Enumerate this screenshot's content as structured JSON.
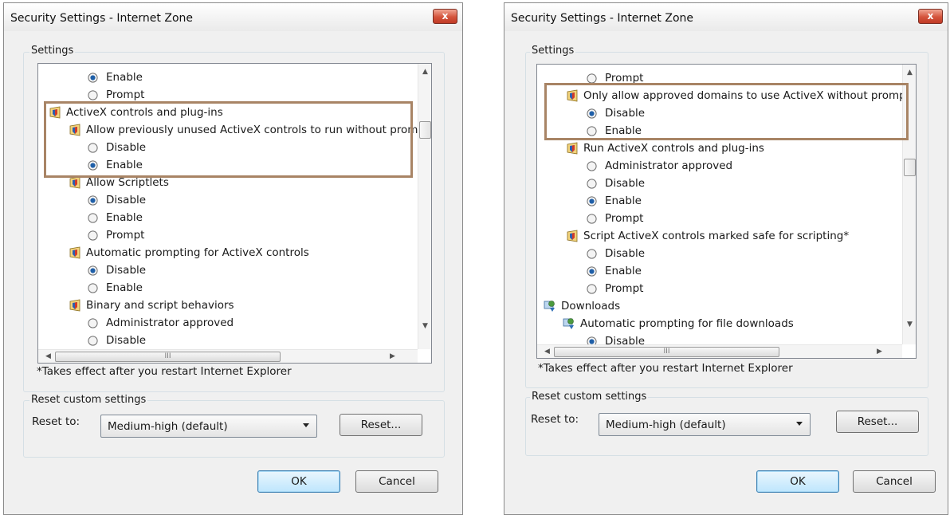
{
  "accent_colors": {
    "highlight": "#a88465",
    "close": "#c03a25",
    "default_button": "#bee6fd"
  },
  "dialogs": [
    {
      "title": "Security Settings - Internet Zone",
      "close_label": "x",
      "settings_legend": "Settings",
      "items": [
        {
          "type": "radio",
          "text": "Enable",
          "checked": true
        },
        {
          "type": "radio",
          "text": "Prompt",
          "checked": false
        },
        {
          "type": "header",
          "icon": "shield-icon",
          "text": "ActiveX controls and plug-ins"
        },
        {
          "type": "sub",
          "icon": "shield-icon",
          "text": "Allow previously unused ActiveX controls to run without prompt"
        },
        {
          "type": "radio",
          "text": "Disable",
          "checked": false
        },
        {
          "type": "radio",
          "text": "Enable",
          "checked": true
        },
        {
          "type": "sub",
          "icon": "shield-icon",
          "text": "Allow Scriptlets"
        },
        {
          "type": "radio",
          "text": "Disable",
          "checked": true
        },
        {
          "type": "radio",
          "text": "Enable",
          "checked": false
        },
        {
          "type": "radio",
          "text": "Prompt",
          "checked": false
        },
        {
          "type": "sub",
          "icon": "shield-icon",
          "text": "Automatic prompting for ActiveX controls"
        },
        {
          "type": "radio",
          "text": "Disable",
          "checked": true
        },
        {
          "type": "radio",
          "text": "Enable",
          "checked": false
        },
        {
          "type": "sub",
          "icon": "shield-icon",
          "text": "Binary and script behaviors"
        },
        {
          "type": "radio",
          "text": "Administrator approved",
          "checked": false
        },
        {
          "type": "radio",
          "text": "Disable",
          "checked": false
        }
      ],
      "scroll_grip": "III",
      "note": "*Takes effect after you restart Internet Explorer",
      "reset_legend": "Reset custom settings",
      "reset_to_label": "Reset to:",
      "reset_to_value": "Medium-high (default)",
      "reset_button": "Reset...",
      "ok_button": "OK",
      "cancel_button": "Cancel"
    },
    {
      "title": "Security Settings - Internet Zone",
      "close_label": "x",
      "settings_legend": "Settings",
      "items": [
        {
          "type": "radio",
          "text": "Prompt",
          "checked": false
        },
        {
          "type": "sub",
          "icon": "shield-icon",
          "text": "Only allow approved domains to use ActiveX without prompt"
        },
        {
          "type": "radio",
          "text": "Disable",
          "checked": true
        },
        {
          "type": "radio",
          "text": "Enable",
          "checked": false
        },
        {
          "type": "sub",
          "icon": "shield-icon",
          "text": "Run ActiveX controls and plug-ins"
        },
        {
          "type": "radio",
          "text": "Administrator approved",
          "checked": false
        },
        {
          "type": "radio",
          "text": "Disable",
          "checked": false
        },
        {
          "type": "radio",
          "text": "Enable",
          "checked": true
        },
        {
          "type": "radio",
          "text": "Prompt",
          "checked": false
        },
        {
          "type": "sub",
          "icon": "shield-icon",
          "text": "Script ActiveX controls marked safe for scripting*"
        },
        {
          "type": "radio",
          "text": "Disable",
          "checked": false
        },
        {
          "type": "radio",
          "text": "Enable",
          "checked": true
        },
        {
          "type": "radio",
          "text": "Prompt",
          "checked": false
        },
        {
          "type": "header",
          "icon": "downloads-icon",
          "text": "Downloads"
        },
        {
          "type": "sub",
          "icon": "downloads-icon",
          "text": "Automatic prompting for file downloads"
        },
        {
          "type": "radio",
          "text": "Disable",
          "checked": true
        }
      ],
      "scroll_grip": "III",
      "note": "*Takes effect after you restart Internet Explorer",
      "reset_legend": "Reset custom settings",
      "reset_to_label": "Reset to:",
      "reset_to_value": "Medium-high (default)",
      "reset_button": "Reset...",
      "ok_button": "OK",
      "cancel_button": "Cancel"
    }
  ]
}
